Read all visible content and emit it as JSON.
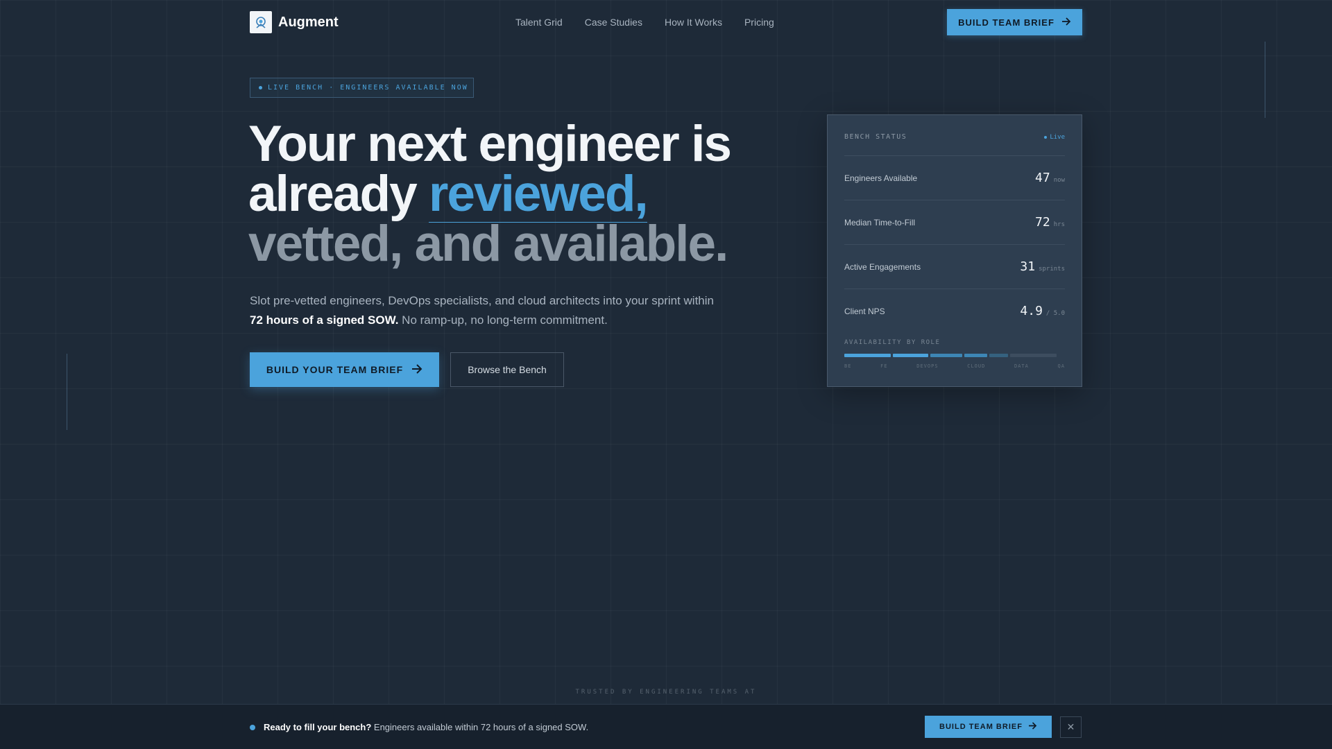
{
  "nav": {
    "brand": "Augment",
    "links": [
      "Talent Grid",
      "Case Studies",
      "How It Works",
      "Pricing"
    ],
    "cta_label": "BUILD TEAM BRIEF"
  },
  "hero": {
    "badge": "LIVE BENCH · ENGINEERS AVAILABLE NOW",
    "headline_line1": "Your next engineer is",
    "headline_line2_prefix": "already ",
    "headline_highlight": "reviewed,",
    "headline_line3": "vetted, and available.",
    "sub_text": "Slot pre-vetted engineers, DevOps specialists, and cloud architects into your sprint within",
    "sub_bold": "72 hours of a signed SOW.",
    "sub_tail": " No ramp-up, no long-term commitment.",
    "primary_cta": "BUILD YOUR TEAM BRIEF",
    "secondary_cta": "Browse the Bench"
  },
  "bench_card": {
    "title": "BENCH STATUS",
    "live_label": "Live",
    "stats": [
      {
        "label": "Engineers Available",
        "value": "47",
        "unit": "now"
      },
      {
        "label": "Median Time-to-Fill",
        "value": "72",
        "unit": "hrs"
      },
      {
        "label": "Active Engagements",
        "value": "31",
        "unit": "sprints"
      },
      {
        "label": "Client NPS",
        "value": "4.9",
        "unit": "/ 5.0"
      }
    ],
    "availability_title": "AVAILABILITY BY ROLE",
    "roles": [
      "BE",
      "FE",
      "DEVOPS",
      "CLOUD",
      "DATA",
      "QA"
    ],
    "availability_fractions": [
      0.22,
      0.17,
      0.15,
      0.11,
      0.09,
      0.22
    ],
    "colors": {
      "strong": "#4ba3dc",
      "mid": "#3d86b5",
      "weak": "#35617f",
      "empty": "#3d4d5f"
    }
  },
  "trusted": "TRUSTED BY ENGINEERING TEAMS AT",
  "bottom_bar": {
    "bold": "Ready to fill your bench?",
    "text": " Engineers available within 72 hours of a signed SOW.",
    "cta_label": "BUILD TEAM BRIEF",
    "close_icon": "close-icon"
  }
}
